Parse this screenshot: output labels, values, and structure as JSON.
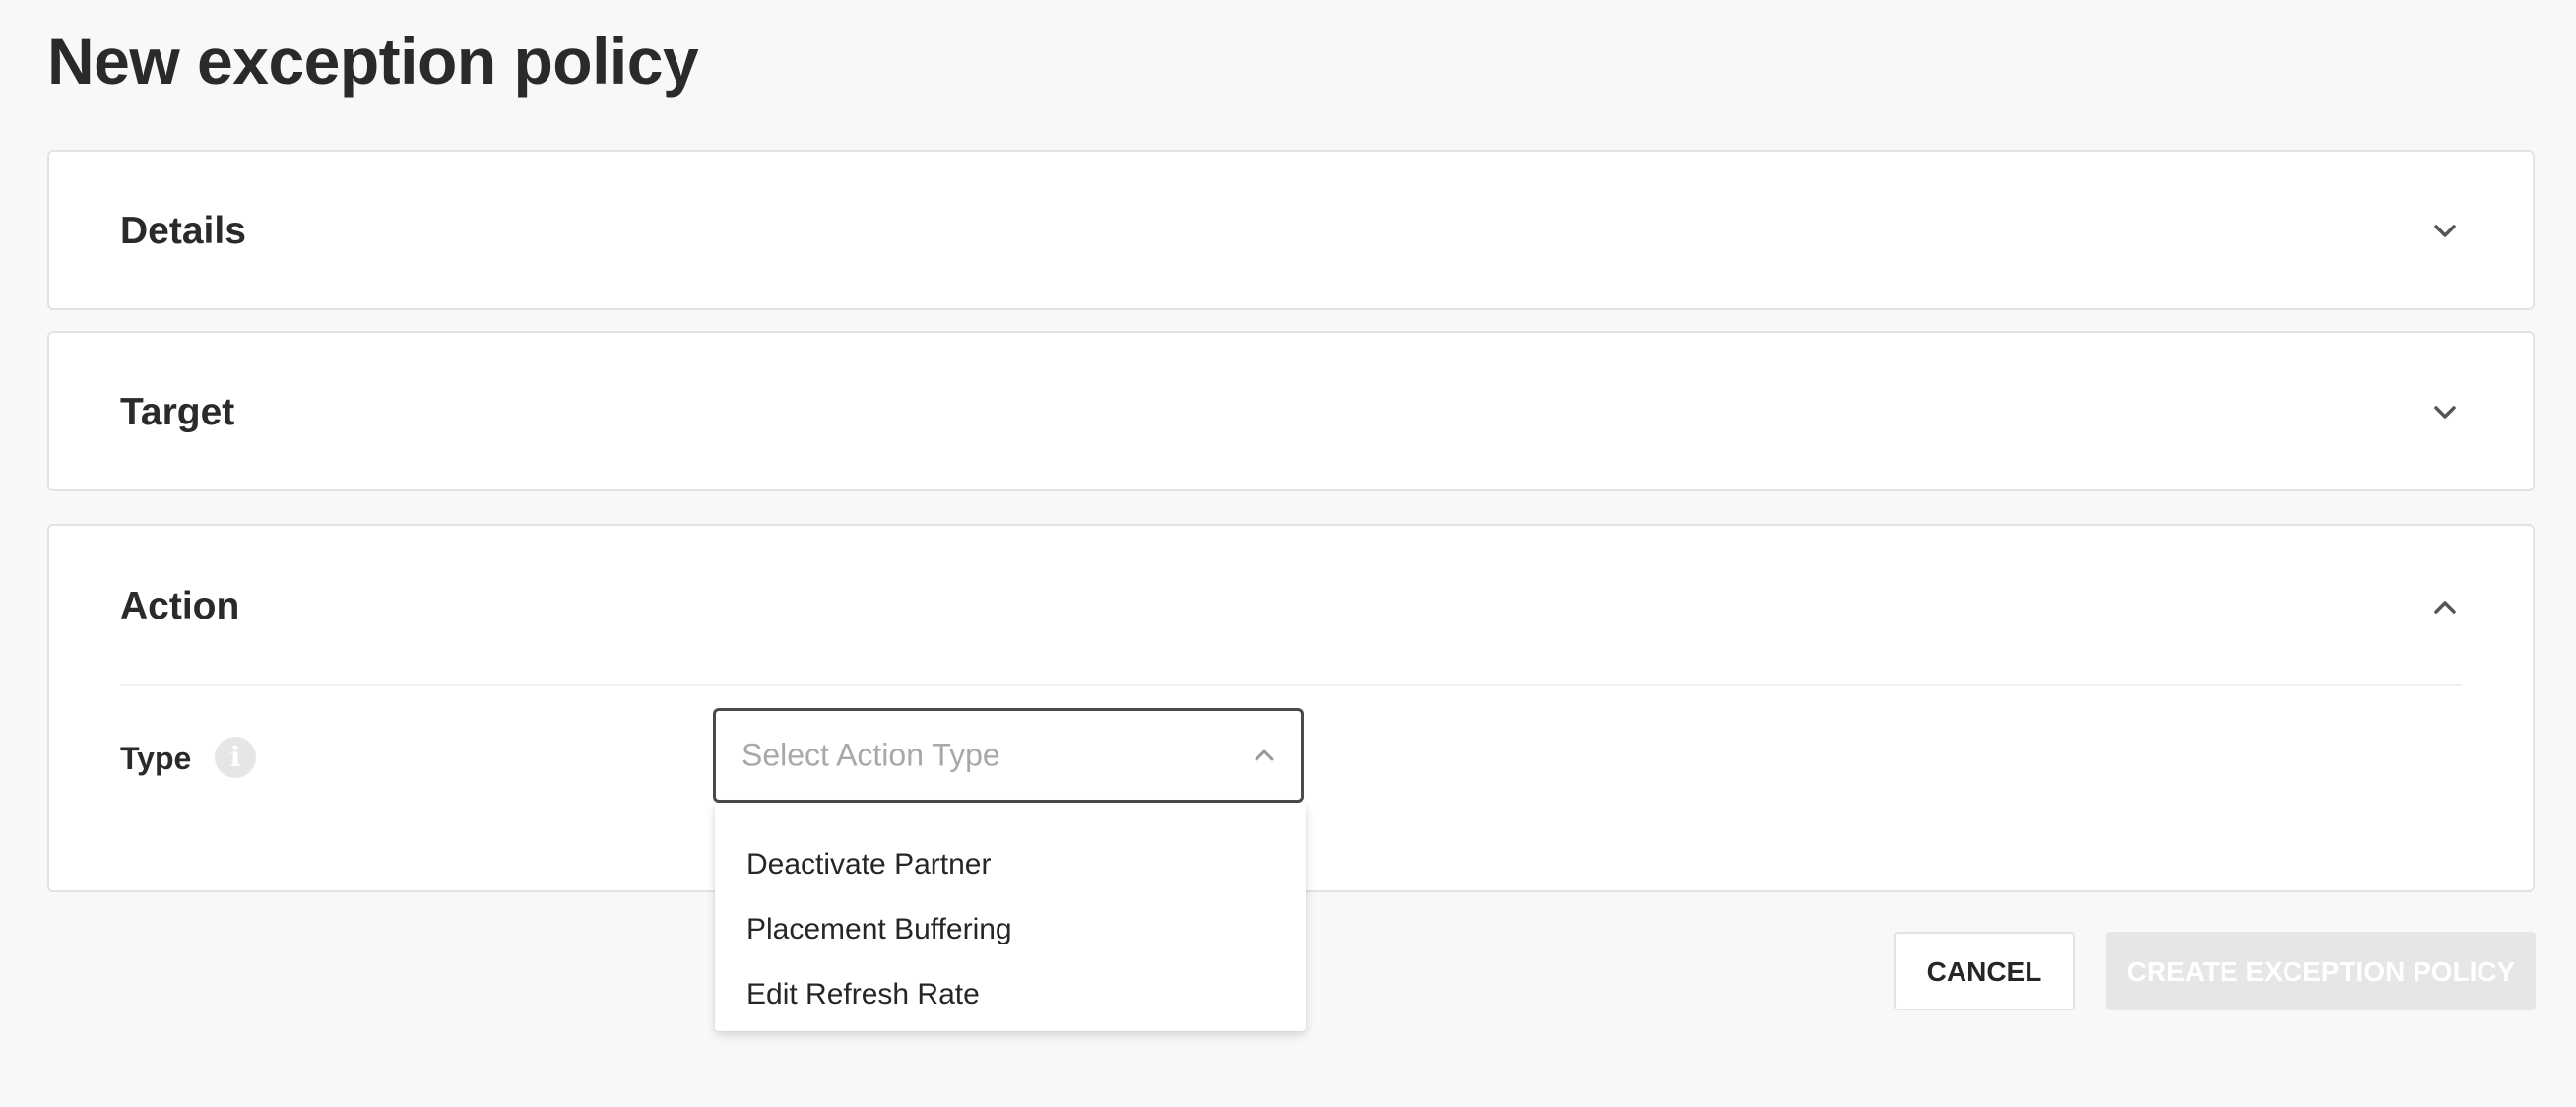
{
  "page": {
    "title": "New exception policy"
  },
  "sections": {
    "details": {
      "title": "Details",
      "expanded": false
    },
    "target": {
      "title": "Target",
      "expanded": false
    },
    "action": {
      "title": "Action",
      "expanded": true,
      "type_label": "Type",
      "info_icon": "info-icon",
      "select": {
        "placeholder": "Select Action Type",
        "open": true,
        "options": [
          "Deactivate Partner",
          "Placement Buffering",
          "Edit Refresh Rate"
        ]
      }
    }
  },
  "buttons": {
    "cancel": "CANCEL",
    "create": "CREATE EXCEPTION POLICY"
  },
  "colors": {
    "background": "#f8f8f8",
    "panel": "#ffffff",
    "text": "#262626",
    "placeholder": "#a8a8a8",
    "disabled_button": "#e6e6e6"
  }
}
